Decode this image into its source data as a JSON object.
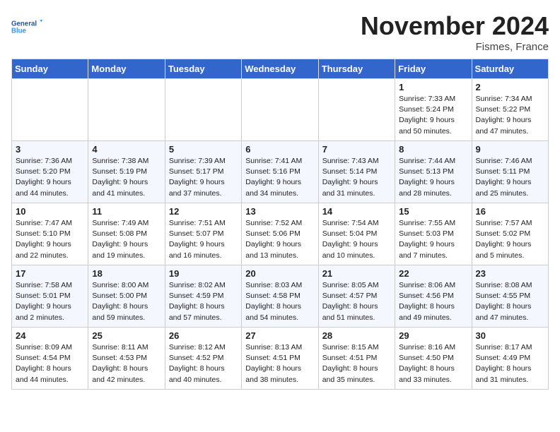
{
  "header": {
    "logo_general": "General",
    "logo_blue": "Blue",
    "month_title": "November 2024",
    "location": "Fismes, France"
  },
  "days_of_week": [
    "Sunday",
    "Monday",
    "Tuesday",
    "Wednesday",
    "Thursday",
    "Friday",
    "Saturday"
  ],
  "weeks": [
    [
      {
        "day": "",
        "detail": ""
      },
      {
        "day": "",
        "detail": ""
      },
      {
        "day": "",
        "detail": ""
      },
      {
        "day": "",
        "detail": ""
      },
      {
        "day": "",
        "detail": ""
      },
      {
        "day": "1",
        "detail": "Sunrise: 7:33 AM\nSunset: 5:24 PM\nDaylight: 9 hours and 50 minutes."
      },
      {
        "day": "2",
        "detail": "Sunrise: 7:34 AM\nSunset: 5:22 PM\nDaylight: 9 hours and 47 minutes."
      }
    ],
    [
      {
        "day": "3",
        "detail": "Sunrise: 7:36 AM\nSunset: 5:20 PM\nDaylight: 9 hours and 44 minutes."
      },
      {
        "day": "4",
        "detail": "Sunrise: 7:38 AM\nSunset: 5:19 PM\nDaylight: 9 hours and 41 minutes."
      },
      {
        "day": "5",
        "detail": "Sunrise: 7:39 AM\nSunset: 5:17 PM\nDaylight: 9 hours and 37 minutes."
      },
      {
        "day": "6",
        "detail": "Sunrise: 7:41 AM\nSunset: 5:16 PM\nDaylight: 9 hours and 34 minutes."
      },
      {
        "day": "7",
        "detail": "Sunrise: 7:43 AM\nSunset: 5:14 PM\nDaylight: 9 hours and 31 minutes."
      },
      {
        "day": "8",
        "detail": "Sunrise: 7:44 AM\nSunset: 5:13 PM\nDaylight: 9 hours and 28 minutes."
      },
      {
        "day": "9",
        "detail": "Sunrise: 7:46 AM\nSunset: 5:11 PM\nDaylight: 9 hours and 25 minutes."
      }
    ],
    [
      {
        "day": "10",
        "detail": "Sunrise: 7:47 AM\nSunset: 5:10 PM\nDaylight: 9 hours and 22 minutes."
      },
      {
        "day": "11",
        "detail": "Sunrise: 7:49 AM\nSunset: 5:08 PM\nDaylight: 9 hours and 19 minutes."
      },
      {
        "day": "12",
        "detail": "Sunrise: 7:51 AM\nSunset: 5:07 PM\nDaylight: 9 hours and 16 minutes."
      },
      {
        "day": "13",
        "detail": "Sunrise: 7:52 AM\nSunset: 5:06 PM\nDaylight: 9 hours and 13 minutes."
      },
      {
        "day": "14",
        "detail": "Sunrise: 7:54 AM\nSunset: 5:04 PM\nDaylight: 9 hours and 10 minutes."
      },
      {
        "day": "15",
        "detail": "Sunrise: 7:55 AM\nSunset: 5:03 PM\nDaylight: 9 hours and 7 minutes."
      },
      {
        "day": "16",
        "detail": "Sunrise: 7:57 AM\nSunset: 5:02 PM\nDaylight: 9 hours and 5 minutes."
      }
    ],
    [
      {
        "day": "17",
        "detail": "Sunrise: 7:58 AM\nSunset: 5:01 PM\nDaylight: 9 hours and 2 minutes."
      },
      {
        "day": "18",
        "detail": "Sunrise: 8:00 AM\nSunset: 5:00 PM\nDaylight: 8 hours and 59 minutes."
      },
      {
        "day": "19",
        "detail": "Sunrise: 8:02 AM\nSunset: 4:59 PM\nDaylight: 8 hours and 57 minutes."
      },
      {
        "day": "20",
        "detail": "Sunrise: 8:03 AM\nSunset: 4:58 PM\nDaylight: 8 hours and 54 minutes."
      },
      {
        "day": "21",
        "detail": "Sunrise: 8:05 AM\nSunset: 4:57 PM\nDaylight: 8 hours and 51 minutes."
      },
      {
        "day": "22",
        "detail": "Sunrise: 8:06 AM\nSunset: 4:56 PM\nDaylight: 8 hours and 49 minutes."
      },
      {
        "day": "23",
        "detail": "Sunrise: 8:08 AM\nSunset: 4:55 PM\nDaylight: 8 hours and 47 minutes."
      }
    ],
    [
      {
        "day": "24",
        "detail": "Sunrise: 8:09 AM\nSunset: 4:54 PM\nDaylight: 8 hours and 44 minutes."
      },
      {
        "day": "25",
        "detail": "Sunrise: 8:11 AM\nSunset: 4:53 PM\nDaylight: 8 hours and 42 minutes."
      },
      {
        "day": "26",
        "detail": "Sunrise: 8:12 AM\nSunset: 4:52 PM\nDaylight: 8 hours and 40 minutes."
      },
      {
        "day": "27",
        "detail": "Sunrise: 8:13 AM\nSunset: 4:51 PM\nDaylight: 8 hours and 38 minutes."
      },
      {
        "day": "28",
        "detail": "Sunrise: 8:15 AM\nSunset: 4:51 PM\nDaylight: 8 hours and 35 minutes."
      },
      {
        "day": "29",
        "detail": "Sunrise: 8:16 AM\nSunset: 4:50 PM\nDaylight: 8 hours and 33 minutes."
      },
      {
        "day": "30",
        "detail": "Sunrise: 8:17 AM\nSunset: 4:49 PM\nDaylight: 8 hours and 31 minutes."
      }
    ]
  ]
}
